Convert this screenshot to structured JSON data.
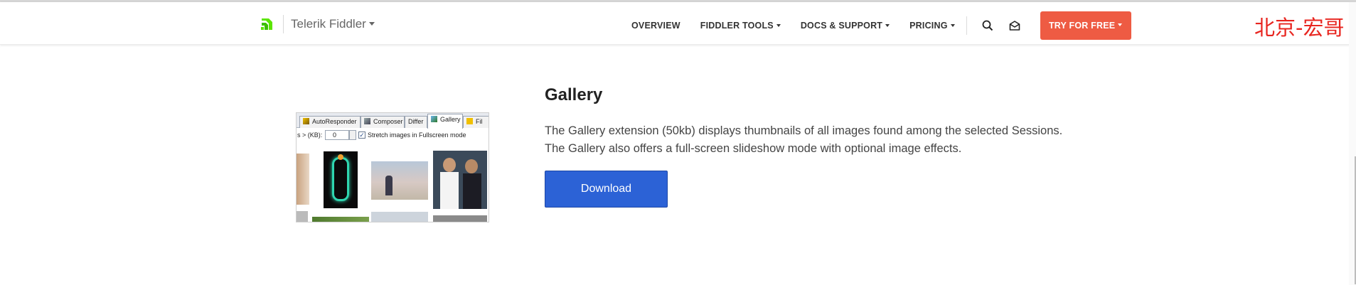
{
  "header": {
    "brand_name": "Telerik Fiddler",
    "nav": [
      {
        "label": "OVERVIEW",
        "has_caret": false
      },
      {
        "label": "FIDDLER TOOLS",
        "has_caret": true
      },
      {
        "label": "DOCS & SUPPORT",
        "has_caret": true
      },
      {
        "label": "PRICING",
        "has_caret": true
      }
    ],
    "cta_label": "TRY FOR FREE",
    "icons": [
      "search-icon",
      "mail-icon"
    ],
    "colors": {
      "cta": "#ee5b43",
      "logo": "#5ce500"
    }
  },
  "watermark": "北京-宏哥",
  "extension": {
    "title": "Gallery",
    "description_line1": "The Gallery extension (50kb) displays thumbnails of all images found among the selected Sessions.",
    "description_line2": "The Gallery also offers a full-screen slideshow mode with optional image effects.",
    "download_label": "Download",
    "download_color": "#2c62d6"
  },
  "screenshot": {
    "tabs": [
      "AutoResponder",
      "Composer",
      "Differ",
      "Gallery",
      "Fil"
    ],
    "min_size_label": "s > (KB):",
    "min_size_value": "0",
    "checkbox_label": "Stretch images in Fullscreen mode",
    "checkbox_checked": "✓"
  }
}
